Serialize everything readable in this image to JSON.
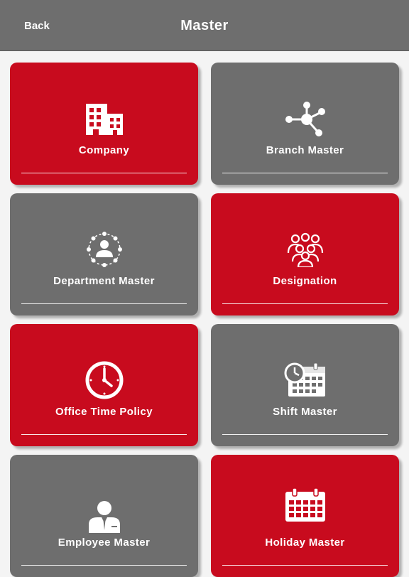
{
  "header": {
    "back_label": "Back",
    "title": "Master"
  },
  "tiles": [
    {
      "label": "Company",
      "icon": "building-icon",
      "color": "#c80b1e"
    },
    {
      "label": "Branch Master",
      "icon": "network-icon",
      "color": "#6e6e6e"
    },
    {
      "label": "Department Master",
      "icon": "department-network-icon",
      "color": "#6e6e6e"
    },
    {
      "label": "Designation",
      "icon": "people-group-icon",
      "color": "#c80b1e"
    },
    {
      "label": "Office Time Policy",
      "icon": "clock-icon",
      "color": "#c80b1e"
    },
    {
      "label": "Shift Master",
      "icon": "calendar-clock-icon",
      "color": "#6e6e6e"
    },
    {
      "label": "Employee Master",
      "icon": "employee-icon",
      "color": "#6e6e6e"
    },
    {
      "label": "Holiday Master",
      "icon": "calendar-icon",
      "color": "#c80b1e"
    }
  ]
}
